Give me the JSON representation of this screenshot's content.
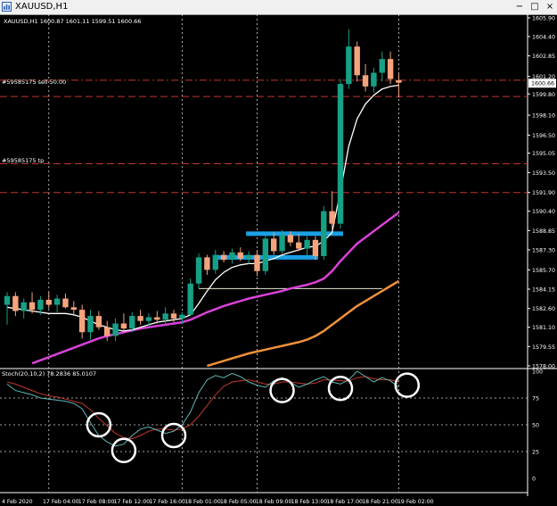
{
  "window": {
    "title": "XAUUSD,H1",
    "buttons": {
      "minimize": "−",
      "maximize": "□",
      "close": "×"
    }
  },
  "main_chart": {
    "ohlc_text": "XAUUSD,H1  1600.87 1601.11 1599.51 1600.66",
    "order_labels": [
      "#59585175 sell 50.00",
      "#59585175 tp"
    ],
    "price_ticks": [
      "1605.90",
      "1604.40",
      "1602.85",
      "1601.20",
      "1599.80",
      "1598.10",
      "1596.50",
      "1595.05",
      "1593.50",
      "1591.90",
      "1590.40",
      "1588.85",
      "1587.30",
      "1585.70",
      "1584.15",
      "1582.60",
      "1581.10",
      "1579.55",
      "1578.00"
    ],
    "current_price": "1600.66"
  },
  "stoch_panel": {
    "label": "Stoch(20,10,2) 78.2836 85.0107",
    "ticks": [
      "100",
      "75",
      "50",
      "25",
      "0"
    ]
  },
  "time_axis": [
    "4 Feb 2020",
    "17 Feb 04:00",
    "17 Feb 08:00",
    "17 Feb 12:00",
    "17 Feb 16:00",
    "18 Feb 01:00",
    "18 Feb 05:00",
    "18 Feb 09:00",
    "18 Feb 13:00",
    "18 Feb 17:00",
    "18 Feb 21:00",
    "19 Feb 02:00"
  ],
  "colors": {
    "background": "#000000",
    "bull_candle": "#16a085",
    "bear_candle": "#f4a47c",
    "ma_fast": "#ffffff",
    "ma_mid": "#d942d9",
    "ma_slow": "#f0913a",
    "zone": "#1aa0e6",
    "stoch_main": "#5fb7b5",
    "stoch_signal": "#c0392b"
  },
  "chart_data": {
    "type": "candlestick",
    "timeframe": "H1",
    "price_range": [
      1578.0,
      1605.9
    ],
    "candles": [
      {
        "o": 1582.9,
        "h": 1583.9,
        "l": 1581.3,
        "c": 1583.6
      },
      {
        "o": 1583.6,
        "h": 1583.9,
        "l": 1582.0,
        "c": 1582.4
      },
      {
        "o": 1582.4,
        "h": 1583.4,
        "l": 1581.8,
        "c": 1583.1
      },
      {
        "o": 1583.1,
        "h": 1583.9,
        "l": 1582.2,
        "c": 1582.5
      },
      {
        "o": 1582.5,
        "h": 1583.6,
        "l": 1582.1,
        "c": 1583.3
      },
      {
        "o": 1583.3,
        "h": 1583.9,
        "l": 1582.6,
        "c": 1582.9
      },
      {
        "o": 1582.9,
        "h": 1583.7,
        "l": 1582.3,
        "c": 1583.4
      },
      {
        "o": 1583.4,
        "h": 1583.8,
        "l": 1582.6,
        "c": 1582.7
      },
      {
        "o": 1582.7,
        "h": 1583.2,
        "l": 1582.0,
        "c": 1582.5
      },
      {
        "o": 1582.5,
        "h": 1582.9,
        "l": 1580.2,
        "c": 1580.7
      },
      {
        "o": 1580.7,
        "h": 1582.5,
        "l": 1580.1,
        "c": 1582.0
      },
      {
        "o": 1582.0,
        "h": 1582.4,
        "l": 1580.9,
        "c": 1581.1
      },
      {
        "o": 1581.1,
        "h": 1581.6,
        "l": 1580.0,
        "c": 1580.4
      },
      {
        "o": 1580.4,
        "h": 1581.8,
        "l": 1580.0,
        "c": 1581.4
      },
      {
        "o": 1581.4,
        "h": 1582.2,
        "l": 1580.8,
        "c": 1581.0
      },
      {
        "o": 1581.0,
        "h": 1582.3,
        "l": 1580.7,
        "c": 1582.0
      },
      {
        "o": 1582.0,
        "h": 1582.5,
        "l": 1581.3,
        "c": 1581.6
      },
      {
        "o": 1581.6,
        "h": 1582.2,
        "l": 1581.2,
        "c": 1581.9
      },
      {
        "o": 1581.9,
        "h": 1582.4,
        "l": 1581.4,
        "c": 1581.7
      },
      {
        "o": 1581.7,
        "h": 1582.7,
        "l": 1581.4,
        "c": 1582.2
      },
      {
        "o": 1582.2,
        "h": 1582.5,
        "l": 1581.5,
        "c": 1581.8
      },
      {
        "o": 1581.8,
        "h": 1582.3,
        "l": 1581.4,
        "c": 1582.1
      },
      {
        "o": 1582.1,
        "h": 1585.0,
        "l": 1582.0,
        "c": 1584.6
      },
      {
        "o": 1584.6,
        "h": 1587.0,
        "l": 1584.2,
        "c": 1586.7
      },
      {
        "o": 1586.7,
        "h": 1586.9,
        "l": 1585.3,
        "c": 1585.7
      },
      {
        "o": 1585.7,
        "h": 1587.3,
        "l": 1585.4,
        "c": 1586.9
      },
      {
        "o": 1586.9,
        "h": 1587.2,
        "l": 1586.3,
        "c": 1586.5
      },
      {
        "o": 1586.5,
        "h": 1587.4,
        "l": 1586.2,
        "c": 1587.1
      },
      {
        "o": 1587.1,
        "h": 1587.5,
        "l": 1586.4,
        "c": 1586.6
      },
      {
        "o": 1586.6,
        "h": 1587.2,
        "l": 1586.2,
        "c": 1586.9
      },
      {
        "o": 1586.9,
        "h": 1587.3,
        "l": 1585.2,
        "c": 1585.6
      },
      {
        "o": 1585.6,
        "h": 1588.5,
        "l": 1585.3,
        "c": 1588.2
      },
      {
        "o": 1588.2,
        "h": 1588.7,
        "l": 1586.9,
        "c": 1587.2
      },
      {
        "o": 1587.2,
        "h": 1588.9,
        "l": 1587.0,
        "c": 1588.5
      },
      {
        "o": 1588.5,
        "h": 1588.8,
        "l": 1587.6,
        "c": 1587.9
      },
      {
        "o": 1587.9,
        "h": 1588.6,
        "l": 1587.2,
        "c": 1587.4
      },
      {
        "o": 1587.4,
        "h": 1588.4,
        "l": 1586.8,
        "c": 1588.1
      },
      {
        "o": 1588.1,
        "h": 1588.4,
        "l": 1586.5,
        "c": 1586.8
      },
      {
        "o": 1586.8,
        "h": 1590.8,
        "l": 1586.5,
        "c": 1590.4
      },
      {
        "o": 1590.4,
        "h": 1592.0,
        "l": 1589.0,
        "c": 1589.4
      },
      {
        "o": 1589.4,
        "h": 1601.0,
        "l": 1589.0,
        "c": 1600.6
      },
      {
        "o": 1600.6,
        "h": 1605.0,
        "l": 1600.2,
        "c": 1603.6
      },
      {
        "o": 1603.6,
        "h": 1604.0,
        "l": 1600.8,
        "c": 1601.3
      },
      {
        "o": 1601.3,
        "h": 1602.2,
        "l": 1600.0,
        "c": 1600.4
      },
      {
        "o": 1600.4,
        "h": 1601.9,
        "l": 1599.9,
        "c": 1601.5
      },
      {
        "o": 1601.5,
        "h": 1603.2,
        "l": 1600.8,
        "c": 1602.6
      },
      {
        "o": 1602.6,
        "h": 1603.2,
        "l": 1600.6,
        "c": 1601.0
      },
      {
        "o": 1600.9,
        "h": 1601.4,
        "l": 1599.5,
        "c": 1600.7
      }
    ],
    "ma_fast": [
      1582.7,
      1582.6,
      1582.5,
      1582.4,
      1582.3,
      1582.2,
      1582.2,
      1582.2,
      1582.1,
      1581.9,
      1581.6,
      1581.3,
      1581.1,
      1580.9,
      1580.8,
      1580.9,
      1581.1,
      1581.3,
      1581.5,
      1581.6,
      1581.7,
      1581.8,
      1582.1,
      1583.0,
      1584.0,
      1584.9,
      1585.5,
      1585.9,
      1586.1,
      1586.2,
      1586.2,
      1586.4,
      1586.6,
      1586.9,
      1587.1,
      1587.3,
      1587.5,
      1587.6,
      1588.0,
      1588.7,
      1592.0,
      1595.6,
      1597.8,
      1599.0,
      1599.7,
      1600.2,
      1600.4,
      1600.5
    ],
    "ma_mid": [
      null,
      null,
      null,
      1578.2,
      1578.45,
      1578.7,
      1578.95,
      1579.2,
      1579.45,
      1579.7,
      1579.95,
      1580.2,
      1580.4,
      1580.55,
      1580.7,
      1580.85,
      1581.0,
      1581.1,
      1581.2,
      1581.3,
      1581.4,
      1581.5,
      1581.7,
      1582.0,
      1582.3,
      1582.55,
      1582.8,
      1583.0,
      1583.2,
      1583.4,
      1583.55,
      1583.7,
      1583.85,
      1584.0,
      1584.2,
      1584.35,
      1584.5,
      1584.7,
      1585.0,
      1585.6,
      1586.4,
      1587.1,
      1587.8,
      1588.3,
      1588.8,
      1589.3,
      1589.8,
      1590.3
    ],
    "ma_slow": [
      null,
      null,
      null,
      null,
      null,
      null,
      null,
      null,
      null,
      null,
      null,
      null,
      null,
      null,
      null,
      null,
      null,
      null,
      null,
      null,
      null,
      null,
      null,
      null,
      1578.0,
      1578.2,
      1578.4,
      1578.6,
      1578.8,
      1579.0,
      1579.15,
      1579.3,
      1579.45,
      1579.6,
      1579.75,
      1579.9,
      1580.1,
      1580.4,
      1580.8,
      1581.3,
      1581.8,
      1582.3,
      1582.8,
      1583.2,
      1583.6,
      1584.0,
      1584.4,
      1584.8
    ],
    "zones": [
      {
        "from": 25,
        "to": 37,
        "price": 1586.7,
        "note": "blue support zone"
      },
      {
        "from": 29,
        "to": 40,
        "price": 1588.6,
        "note": "blue support zone"
      }
    ],
    "horizontal_levels": [
      {
        "price": 1600.9,
        "color": "#c0392b",
        "dash": "dash-dot"
      },
      {
        "price": 1599.6,
        "color": "#c0392b",
        "dash": "dashed"
      },
      {
        "price": 1594.2,
        "color": "#c0392b",
        "dash": "dashed"
      },
      {
        "price": 1591.9,
        "color": "#c0392b",
        "dash": "dashed"
      },
      {
        "price": 1584.2,
        "color": "#e8e8d0",
        "dash": "solid",
        "from": 23,
        "to": 45
      }
    ],
    "stoch_main": [
      88,
      82,
      80,
      78,
      75,
      74,
      73,
      72,
      70,
      65,
      52,
      40,
      34,
      30,
      32,
      40,
      46,
      48,
      45,
      42,
      44,
      50,
      62,
      80,
      92,
      96,
      94,
      98,
      95,
      90,
      87,
      85,
      91,
      94,
      90,
      85,
      88,
      92,
      95,
      90,
      88,
      92,
      100,
      95,
      90,
      94,
      91,
      85
    ],
    "stoch_signal": [
      90,
      88,
      85,
      82,
      79,
      77,
      76,
      74,
      72,
      70,
      64,
      56,
      49,
      42,
      38,
      37,
      40,
      44,
      46,
      46,
      45,
      46,
      50,
      58,
      68,
      78,
      86,
      90,
      91,
      92,
      90,
      88,
      88,
      90,
      90,
      89,
      88,
      89,
      92,
      92,
      91,
      91,
      94,
      95,
      93,
      92,
      92,
      90
    ],
    "stoch_circles": [
      {
        "index": 11,
        "value": 50
      },
      {
        "index": 14,
        "value": 26
      },
      {
        "index": 20,
        "value": 40
      },
      {
        "index": 33,
        "value": 82
      },
      {
        "index": 40,
        "value": 84
      },
      {
        "index": 48,
        "value": 87
      }
    ]
  }
}
